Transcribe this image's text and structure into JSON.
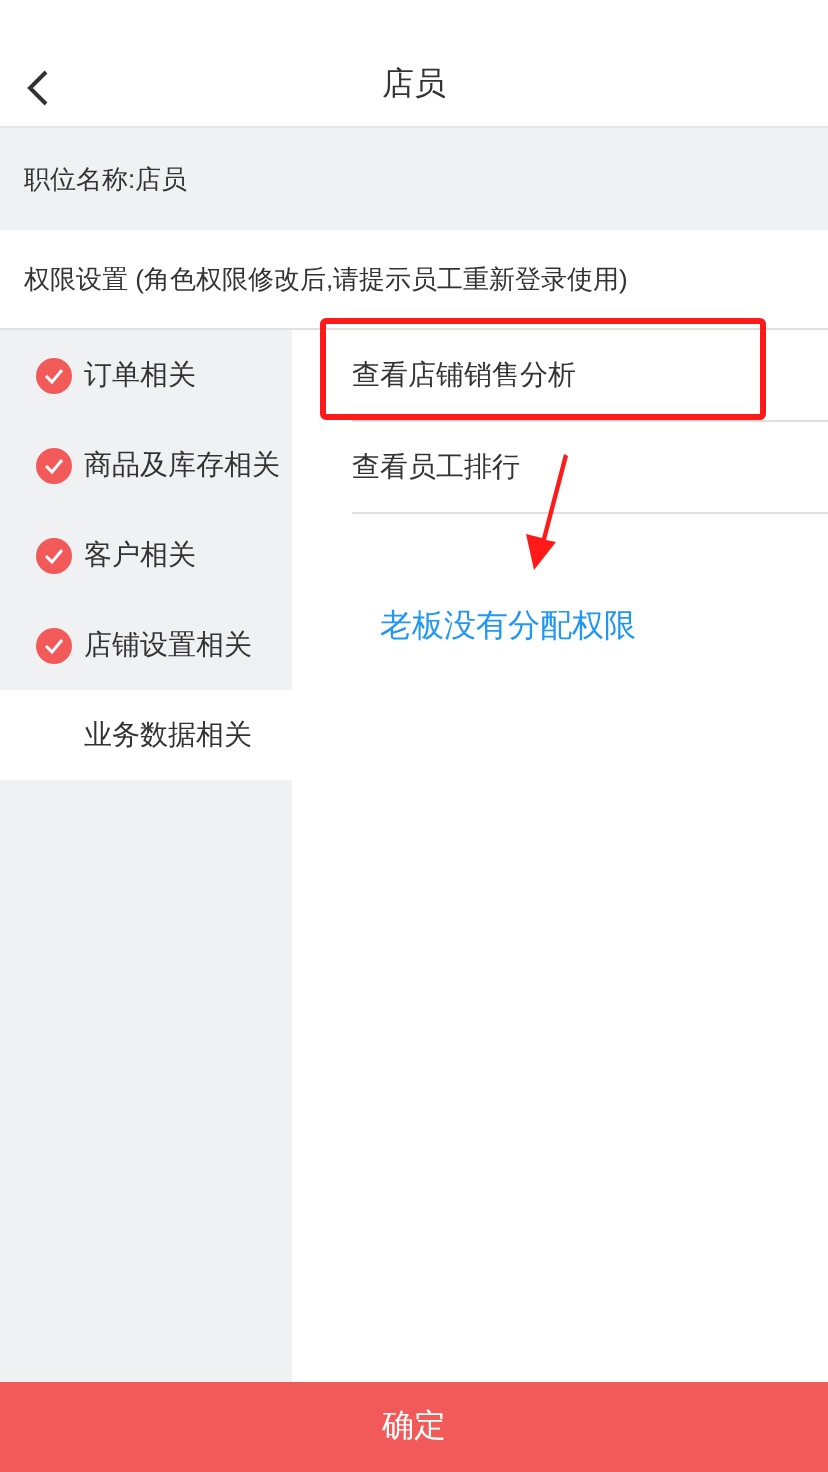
{
  "header": {
    "title": "店员"
  },
  "position_name": "职位名称:店员",
  "permission_heading": "权限设置 (角色权限修改后,请提示员工重新登录使用)",
  "categories": [
    {
      "label": "订单相关",
      "checked": true,
      "selected": false
    },
    {
      "label": "商品及库存相关",
      "checked": true,
      "selected": false
    },
    {
      "label": "客户相关",
      "checked": true,
      "selected": false
    },
    {
      "label": "店铺设置相关",
      "checked": true,
      "selected": false
    },
    {
      "label": "业务数据相关",
      "checked": false,
      "selected": true
    }
  ],
  "permissions": [
    {
      "label": "查看店铺销售分析",
      "highlighted": true
    },
    {
      "label": "查看员工排行",
      "highlighted": false
    }
  ],
  "annotation": "老板没有分配权限",
  "confirm_button": "确定"
}
